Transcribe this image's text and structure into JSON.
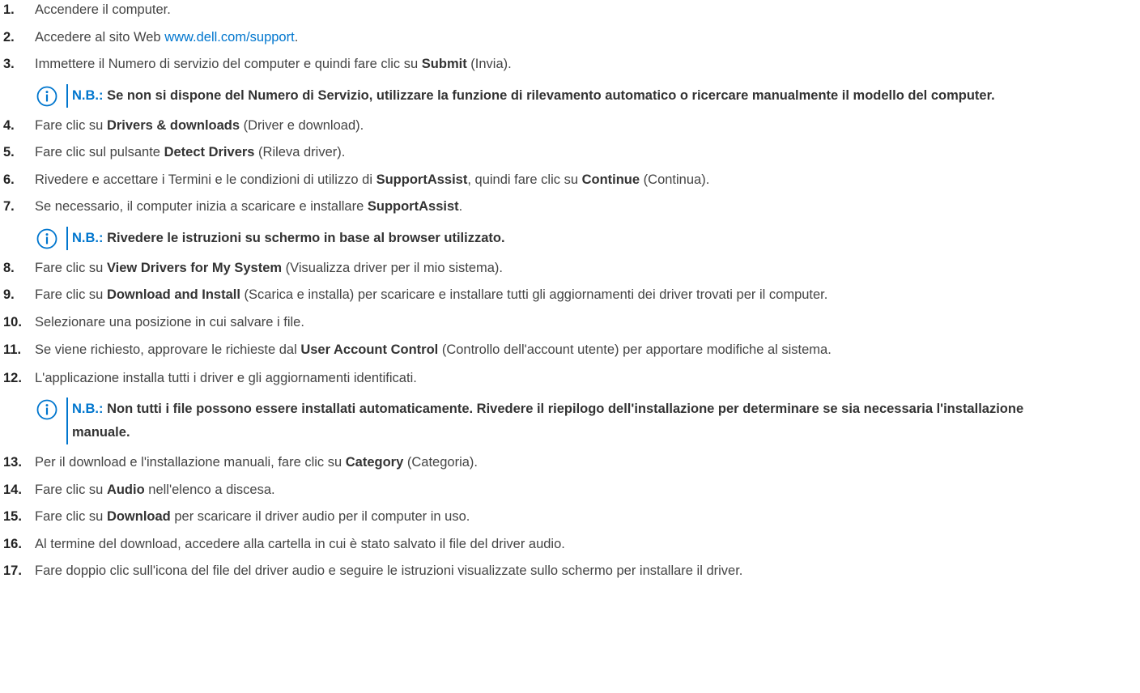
{
  "steps": [
    {
      "num": "1.",
      "t1": "Accendere il computer."
    },
    {
      "num": "2.",
      "t1": "Accedere al sito Web ",
      "link": "www.dell.com/support",
      "t2": "."
    },
    {
      "num": "3.",
      "t1": "Immettere il Numero di servizio del computer e quindi fare clic su ",
      "b1": "Submit",
      "t2": " (Invia)."
    },
    {
      "num": "4.",
      "t1": "Fare clic su ",
      "b1": "Drivers & downloads",
      "t2": " (Driver e download)."
    },
    {
      "num": "5.",
      "t1": "Fare clic sul pulsante ",
      "b1": "Detect Drivers",
      "t2": " (Rileva driver)."
    },
    {
      "num": "6.",
      "t1": "Rivedere e accettare i Termini e le condizioni di utilizzo di ",
      "b1": "SupportAssist",
      "t2": ", quindi fare clic su ",
      "b2": "Continue",
      "t3": " (Continua)."
    },
    {
      "num": "7.",
      "t1": "Se necessario, il computer inizia a scaricare e installare ",
      "b1": "SupportAssist",
      "t2": "."
    },
    {
      "num": "8.",
      "t1": "Fare clic su ",
      "b1": "View Drivers for My System",
      "t2": " (Visualizza driver per il mio sistema)."
    },
    {
      "num": "9.",
      "t1": "Fare clic su ",
      "b1": "Download and Install",
      "t2": " (Scarica e installa) per scaricare e installare tutti gli aggiornamenti dei driver trovati per il computer."
    },
    {
      "num": "10.",
      "t1": "Selezionare una posizione in cui salvare i file."
    },
    {
      "num": "11.",
      "t1": "Se viene richiesto, approvare le richieste dal ",
      "b1": "User Account Control",
      "t2": " (Controllo dell'account utente) per apportare modifiche al sistema."
    },
    {
      "num": "12.",
      "t1": "L'applicazione installa tutti i driver e gli aggiornamenti identificati."
    },
    {
      "num": "13.",
      "t1": "Per il download e l'installazione manuali, fare clic su ",
      "b1": "Category",
      "t2": " (Categoria)."
    },
    {
      "num": "14.",
      "t1": "Fare clic su ",
      "b1": "Audio",
      "t2": " nell'elenco a discesa."
    },
    {
      "num": "15.",
      "t1": "Fare clic su ",
      "b1": "Download",
      "t2": " per scaricare il driver audio per il computer in uso."
    },
    {
      "num": "16.",
      "t1": "Al termine del download, accedere alla cartella in cui è stato salvato il file del driver audio."
    },
    {
      "num": "17.",
      "t1": "Fare doppio clic sull'icona del file del driver audio e seguire le istruzioni visualizzate sullo schermo per installare il driver."
    }
  ],
  "notes": [
    {
      "label": "N.B.:",
      "text": " Se non si dispone del Numero di Servizio, utilizzare la funzione di rilevamento automatico o ricercare manualmente il modello del computer."
    },
    {
      "label": "N.B.:",
      "text": " Rivedere le istruzioni su schermo in base al browser utilizzato."
    },
    {
      "label": "N.B.:",
      "text": " Non tutti i file possono essere installati automaticamente. Rivedere il riepilogo dell'installazione per determinare se sia necessaria l'installazione manuale."
    }
  ],
  "colors": {
    "accent": "#0076ce",
    "text": "#444444"
  },
  "icons": {
    "note": "info-icon"
  }
}
